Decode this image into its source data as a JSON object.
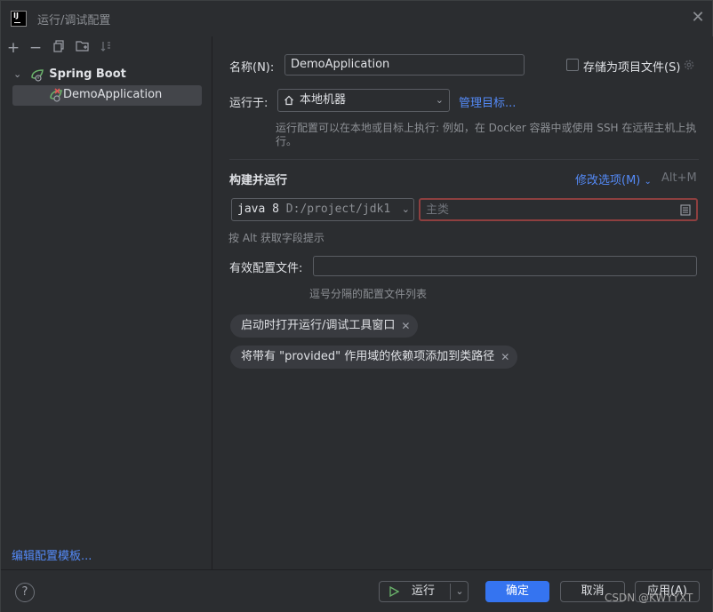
{
  "window": {
    "title": "运行/调试配置",
    "app_icon_text": "IJ"
  },
  "left": {
    "tree": {
      "group_label": "Spring Boot",
      "item_label": "DemoApplication"
    },
    "edit_templates_link": "编辑配置模板..."
  },
  "form": {
    "name_label": "名称(N):",
    "name_value": "DemoApplication",
    "store_as_project_file": "存储为项目文件(S)",
    "run_on_label": "运行于:",
    "run_on_value": "本地机器",
    "manage_targets_link": "管理目标...",
    "run_on_hint": "运行配置可以在本地或目标上执行: 例如，在 Docker 容器中或使用 SSH 在远程主机上执行。",
    "build_run_title": "构建并运行",
    "modify_options_link": "修改选项(M)",
    "modify_options_shortcut": "Alt+M",
    "jdk_value": "java 8",
    "jdk_path": "D:/project/jdk1",
    "main_class_placeholder": "主类",
    "alt_hint": "按 Alt 获取字段提示",
    "active_profiles_label": "有效配置文件:",
    "active_profiles_value": "",
    "active_profiles_hint": "逗号分隔的配置文件列表",
    "chips": [
      "启动时打开运行/调试工具窗口",
      "将带有 \"provided\" 作用域的依赖项添加到类路径"
    ]
  },
  "buttons": {
    "help": "?",
    "run": "运行",
    "ok": "确定",
    "cancel": "取消",
    "apply": "应用(A)"
  },
  "watermark": "CSDN @KWYYXT",
  "colors": {
    "background": "#2b2d30",
    "accent_link": "#548af7",
    "primary_button": "#3574f0",
    "error_border": "#8e3f3f",
    "spring_green": "#6bb36b",
    "error_red": "#e05555"
  }
}
